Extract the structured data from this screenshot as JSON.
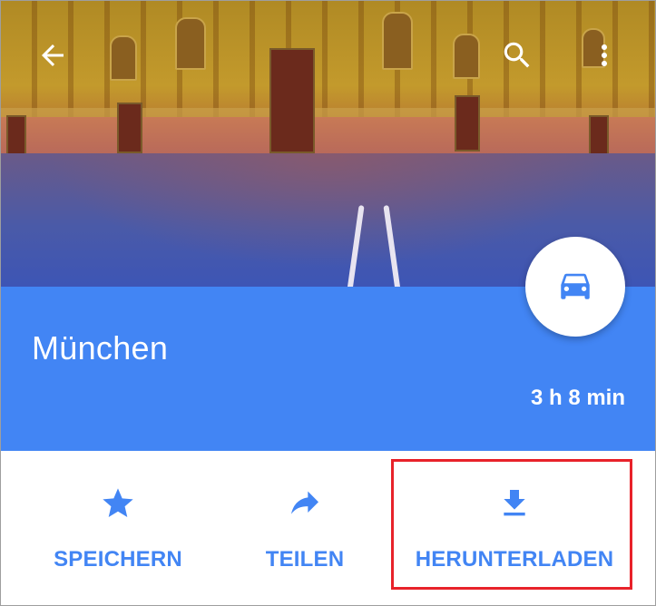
{
  "header": {
    "back_icon": "arrow-back-icon",
    "search_icon": "search-icon",
    "menu_icon": "more-vert-icon"
  },
  "place": {
    "title": "München",
    "duration": "3 h 8 min",
    "mode_icon": "car-icon"
  },
  "actions": [
    {
      "label": "SPEICHERN",
      "icon": "star-icon"
    },
    {
      "label": "TEILEN",
      "icon": "share-icon"
    },
    {
      "label": "HERUNTERLADEN",
      "icon": "download-icon"
    }
  ],
  "colors": {
    "accent": "#4285f4",
    "highlight": "#e8222a"
  }
}
